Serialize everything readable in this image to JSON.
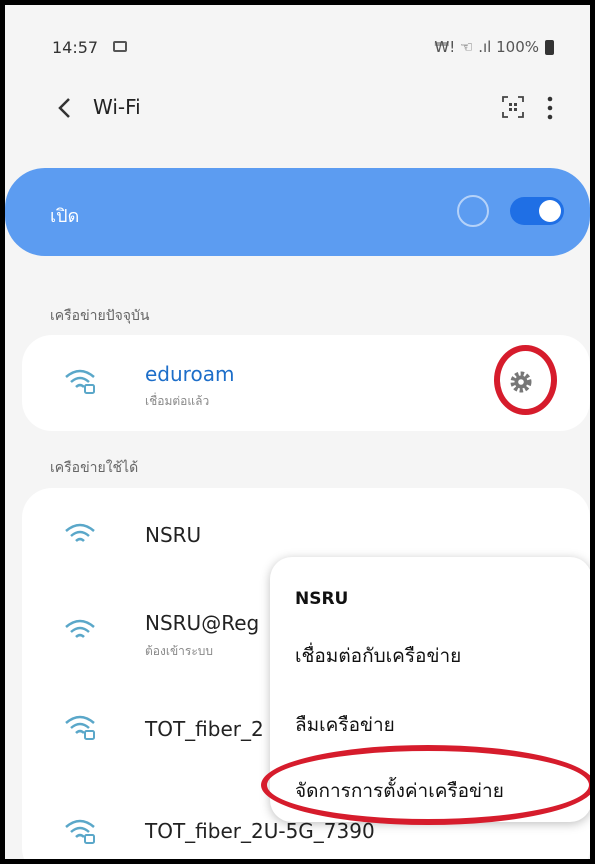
{
  "status_bar": {
    "time": "14:57",
    "signal_text": "₩! ☜ .ıl 100%"
  },
  "app_bar": {
    "title": "Wi-Fi"
  },
  "wifi_switch": {
    "label": "เปิด",
    "enabled": true
  },
  "current_network": {
    "section_label": "เครือข่ายปัจจุบัน",
    "name": "eduroam",
    "status": "เชื่อมต่อแล้ว"
  },
  "available": {
    "section_label": "เครือข่ายใช้ได้",
    "networks": [
      {
        "name": "NSRU",
        "sub": ""
      },
      {
        "name": "NSRU@Reg",
        "sub": "ต้องเข้าระบบ"
      },
      {
        "name": "TOT_fiber_2",
        "sub": ""
      },
      {
        "name": "TOT_fiber_2U-5G_7390",
        "sub": ""
      }
    ]
  },
  "context_menu": {
    "title": "NSRU",
    "items": [
      "เชื่อมต่อกับเครือข่าย",
      "ลืมเครือข่าย",
      "จัดการการตั้งค่าเครือข่าย"
    ]
  },
  "colors": {
    "switch_card": "#5c9cf1",
    "toggle_on": "#1f6fe5",
    "highlight": "#d61c2c",
    "network_name_connected": "#1d6ec9"
  }
}
